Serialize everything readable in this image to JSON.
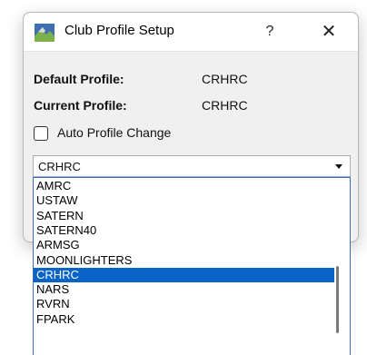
{
  "window": {
    "title": "Club Profile Setup",
    "help_label": "?",
    "close_label": "✕"
  },
  "profile": {
    "default_label": "Default Profile:",
    "default_value": "CRHRC",
    "current_label": "Current Profile:",
    "current_value": "CRHRC"
  },
  "auto_profile_change": {
    "label": "Auto Profile Change",
    "checked": false
  },
  "combo": {
    "selected": "CRHRC"
  },
  "dropdown": {
    "items": [
      "AMRC",
      "USTAW",
      "SATERN",
      "SATERN40",
      "ARMSG",
      "MOONLIGHTERS",
      "CRHRC",
      "NARS",
      "RVRN",
      "FPARK"
    ],
    "highlighted": "CRHRC"
  },
  "colors": {
    "selection": "#0a64c8",
    "dropdown_border": "#3c6fb5"
  }
}
